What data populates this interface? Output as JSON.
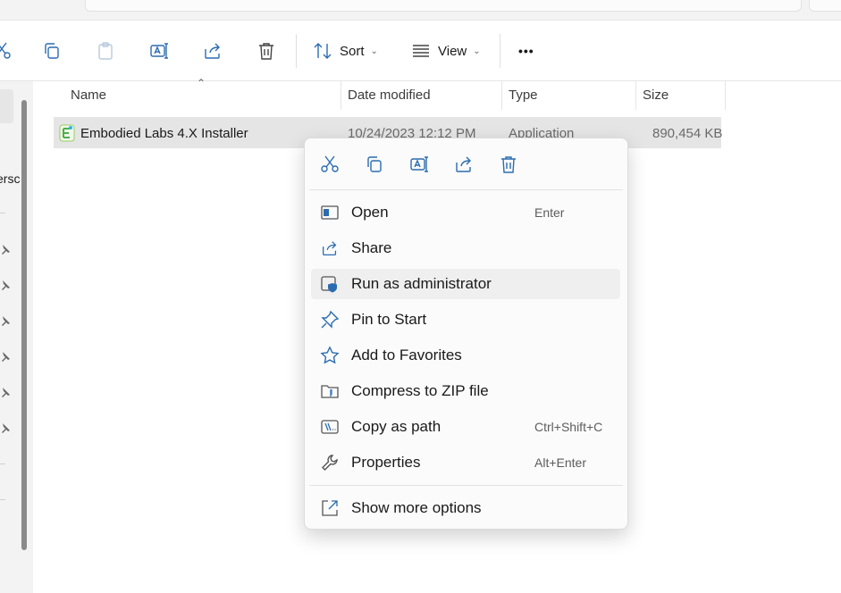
{
  "toolbar": {
    "sort_label": "Sort",
    "view_label": "View",
    "more_label": "•••"
  },
  "nav": {
    "partial_text": "ersc"
  },
  "columns": {
    "name": "Name",
    "date_modified": "Date modified",
    "type": "Type",
    "size": "Size"
  },
  "file": {
    "name": "Embodied Labs 4.X Installer",
    "date": "10/24/2023 12:12 PM",
    "type": "Application",
    "size": "890,454 KB"
  },
  "context_menu": {
    "items": [
      {
        "label": "Open",
        "shortcut": "Enter",
        "icon": "open-icon"
      },
      {
        "label": "Share",
        "shortcut": "",
        "icon": "share-icon"
      },
      {
        "label": "Run as administrator",
        "shortcut": "",
        "icon": "admin-shield-icon"
      },
      {
        "label": "Pin to Start",
        "shortcut": "",
        "icon": "pin-icon"
      },
      {
        "label": "Add to Favorites",
        "shortcut": "",
        "icon": "star-icon"
      },
      {
        "label": "Compress to ZIP file",
        "shortcut": "",
        "icon": "zip-icon"
      },
      {
        "label": "Copy as path",
        "shortcut": "Ctrl+Shift+C",
        "icon": "copy-path-icon"
      },
      {
        "label": "Properties",
        "shortcut": "Alt+Enter",
        "icon": "wrench-icon"
      },
      {
        "label": "Show more options",
        "shortcut": "",
        "icon": "expand-icon"
      }
    ]
  },
  "colors": {
    "accent": "#0067c0",
    "selection": "#e5e5e5",
    "menu_bg": "#fbfbfb"
  }
}
